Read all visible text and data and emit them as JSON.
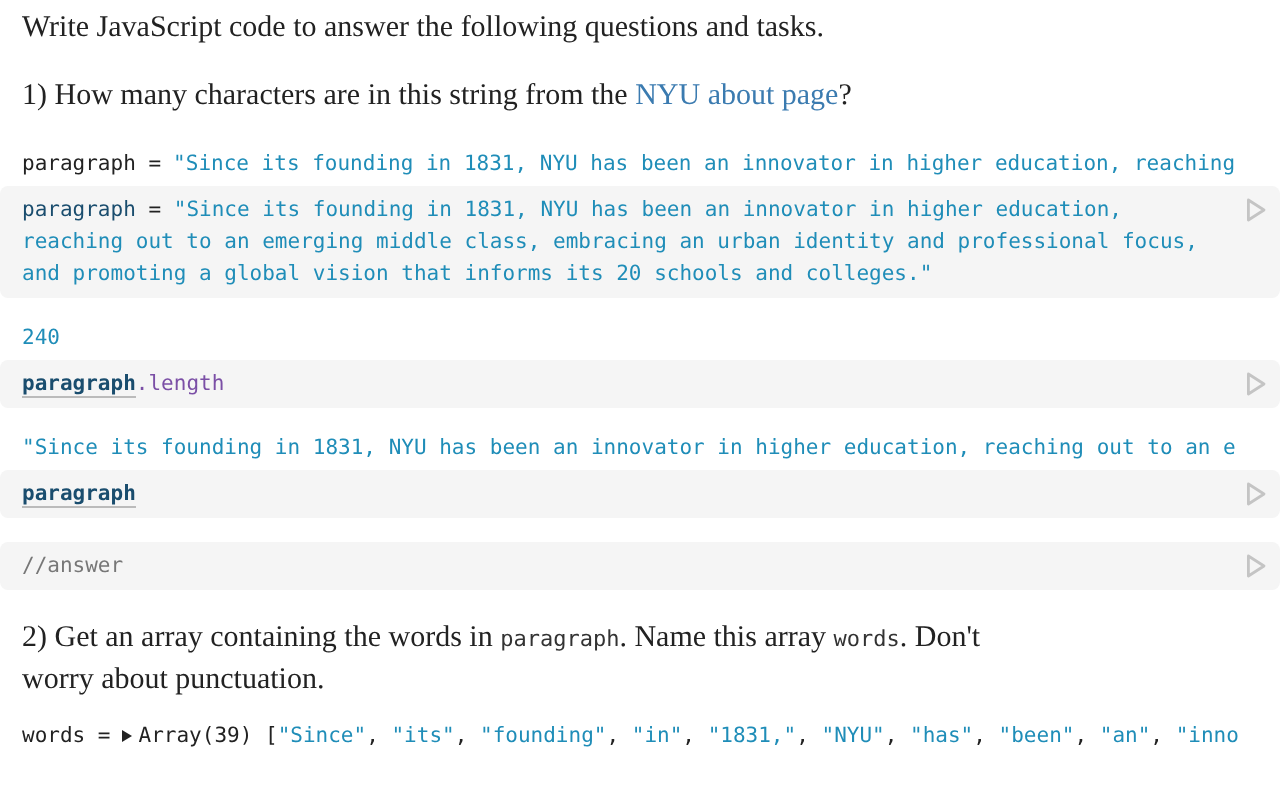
{
  "cells": [
    {
      "kind": "prose",
      "parts": [
        {
          "kind": "text",
          "text": "Write JavaScript code to answer the following questions and tasks."
        }
      ]
    },
    {
      "kind": "prose",
      "parts": [
        {
          "kind": "text",
          "text": "1) How many characters are in this string from the "
        },
        {
          "kind": "link",
          "text": "NYU about page"
        },
        {
          "kind": "text",
          "text": "?"
        }
      ]
    },
    {
      "kind": "output",
      "name": "paragraph =",
      "tokens": [
        {
          "kind": "string",
          "text": "\"Since its founding in 1831, NYU has been an innovator in higher education, reaching"
        }
      ]
    },
    {
      "kind": "code",
      "lines": [
        [
          {
            "kind": "name",
            "text": "paragraph"
          },
          {
            "kind": "op",
            "text": " = "
          },
          {
            "kind": "string",
            "text": "\"Since its founding in 1831, NYU has been an innovator in higher education,"
          }
        ],
        [
          {
            "kind": "string",
            "text": "reaching out to an emerging middle class, embracing an urban identity and professional focus,"
          }
        ],
        [
          {
            "kind": "string",
            "text": "and promoting a global vision that informs its 20 schools and colleges.\""
          }
        ]
      ]
    },
    {
      "kind": "output",
      "tokens": [
        {
          "kind": "number",
          "text": "240"
        }
      ]
    },
    {
      "kind": "code",
      "lines": [
        [
          {
            "kind": "ref",
            "text": "paragraph"
          },
          {
            "kind": "prop",
            "text": ".length"
          }
        ]
      ]
    },
    {
      "kind": "output",
      "tokens": [
        {
          "kind": "string",
          "text": "\"Since its founding in 1831, NYU has been an innovator in higher education, reaching out to an e"
        }
      ]
    },
    {
      "kind": "code",
      "lines": [
        [
          {
            "kind": "ref",
            "text": "paragraph"
          }
        ]
      ]
    },
    {
      "kind": "code",
      "lines": [
        [
          {
            "kind": "comment",
            "text": "//answer"
          }
        ]
      ]
    },
    {
      "kind": "prose",
      "parts": [
        {
          "kind": "text",
          "text": "2) Get an array containing the words in "
        },
        {
          "kind": "code",
          "text": "paragraph"
        },
        {
          "kind": "text",
          "text": ". Name this array "
        },
        {
          "kind": "code",
          "text": "words"
        },
        {
          "kind": "text",
          "text": ". Don't worry about punctuation."
        }
      ]
    },
    {
      "kind": "output",
      "name": "words =",
      "toggle": true,
      "tokens": [
        {
          "kind": "op",
          "text": "Array(39) ["
        },
        {
          "kind": "string",
          "text": "\"Since\""
        },
        {
          "kind": "op",
          "text": ", "
        },
        {
          "kind": "string",
          "text": "\"its\""
        },
        {
          "kind": "op",
          "text": ", "
        },
        {
          "kind": "string",
          "text": "\"founding\""
        },
        {
          "kind": "op",
          "text": ", "
        },
        {
          "kind": "string",
          "text": "\"in\""
        },
        {
          "kind": "op",
          "text": ", "
        },
        {
          "kind": "string",
          "text": "\"1831,\""
        },
        {
          "kind": "op",
          "text": ", "
        },
        {
          "kind": "string",
          "text": "\"NYU\""
        },
        {
          "kind": "op",
          "text": ", "
        },
        {
          "kind": "string",
          "text": "\"has\""
        },
        {
          "kind": "op",
          "text": ", "
        },
        {
          "kind": "string",
          "text": "\"been\""
        },
        {
          "kind": "op",
          "text": ", "
        },
        {
          "kind": "string",
          "text": "\"an\""
        },
        {
          "kind": "op",
          "text": ", "
        },
        {
          "kind": "string",
          "text": "\"inno"
        }
      ]
    }
  ]
}
